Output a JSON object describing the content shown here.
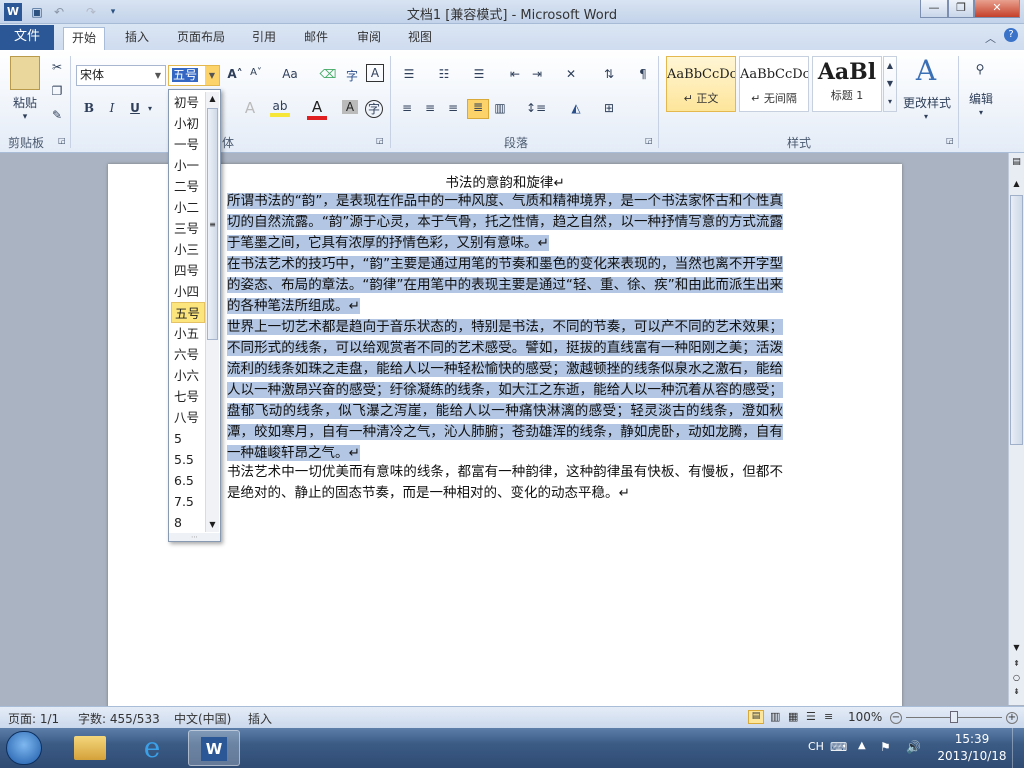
{
  "window": {
    "title": "文档1 [兼容模式] - Microsoft Word",
    "minimize": "—",
    "restore": "❐",
    "close": "✕"
  },
  "tabs": [
    {
      "label": "文件"
    },
    {
      "label": "开始"
    },
    {
      "label": "插入"
    },
    {
      "label": "页面布局"
    },
    {
      "label": "引用"
    },
    {
      "label": "邮件"
    },
    {
      "label": "审阅"
    },
    {
      "label": "视图"
    }
  ],
  "ribbon": {
    "clipboard": {
      "paste": "粘贴",
      "group": "剪贴板"
    },
    "font": {
      "name": "宋体",
      "size": "五号",
      "group": "体",
      "bold": "B",
      "italic": "I",
      "underline": "U",
      "grow": "A˄",
      "shrink": "A˅",
      "case": "Aa",
      "font_color": "A",
      "char_border": "A"
    },
    "paragraph": {
      "group": "段落"
    },
    "styles": {
      "group": "样式",
      "items": [
        {
          "preview": "AaBbCcDc",
          "name": "↵ 正文"
        },
        {
          "preview": "AaBbCcDc",
          "name": "↵ 无间隔"
        },
        {
          "preview": "AaBl",
          "name": "标题 1"
        }
      ],
      "change": "更改样式"
    },
    "editing": {
      "label": "编辑"
    }
  },
  "fontsize_dropdown": {
    "items": [
      "初号",
      "小初",
      "一号",
      "小一",
      "二号",
      "小二",
      "三号",
      "小三",
      "四号",
      "小四",
      "五号",
      "小五",
      "六号",
      "小六",
      "七号",
      "八号",
      "5",
      "5.5",
      "6.5",
      "7.5",
      "8"
    ],
    "selected": "五号"
  },
  "document": {
    "title": "书法的意韵和旋律↵",
    "paragraphs": [
      "所谓书法的“韵”，是表现在作品中的一种风度、气质和精神境界，是一个书法家怀古和个性真切的自然流露。“韵”源于心灵，本于气骨，托之性情，趋之自然，以一种抒情写意的方式流露于笔墨之间，它具有浓厚的抒情色彩，又别有意味。↵",
      "在书法艺术的技巧中，“韵”主要是通过用笔的节奏和墨色的变化来表现的，当然也离不开字型的姿态、布局的章法。“韵律”在用笔中的表现主要是通过“轻、重、徐、疾”和由此而派生出来的各种笔法所组成。↵",
      "世界上一切艺术都是趋向于音乐状态的，特别是书法，不同的节奏，可以产不同的艺术效果；不同形式的线条，可以给观赏者不同的艺术感受。譬如，挺拔的直线富有一种阳刚之美；活泼流利的线条如珠之走盘，能给人以一种轻松愉快的感受；激越顿挫的线条似泉水之激石，能给人以一种激昂兴奋的感受；纡徐凝练的线条，如大江之东逝，能给人以一种沉着从容的感受；盘郁飞动的线条，似飞瀑之泻崖，能给人以一种痛快淋漓的感受；轻灵淡古的线条，澄如秋潭，皎如寒月，自有一种清冷之气，沁人肺腑；苍劲雄浑的线条，静如虎卧，动如龙腾，自有一种雄峻轩昂之气。↵",
      "书法艺术中一切优美而有意味的线条，都富有一种韵律，这种韵律虽有快板、有慢板，但都不是绝对的、静止的固态节奏，而是一种相对的、变化的动态平稳。↵"
    ]
  },
  "statusbar": {
    "page": "页面: 1/1",
    "words": "字数: 455/533",
    "lang": "中文(中国)",
    "mode": "插入",
    "zoom": "100%"
  },
  "taskbar": {
    "ime": "CH",
    "time": "15:39",
    "date": "2013/10/18"
  },
  "colors": {
    "file_tab": "#2b5797",
    "selection": "#b3c7e4",
    "selected_size": "#fde57e"
  }
}
